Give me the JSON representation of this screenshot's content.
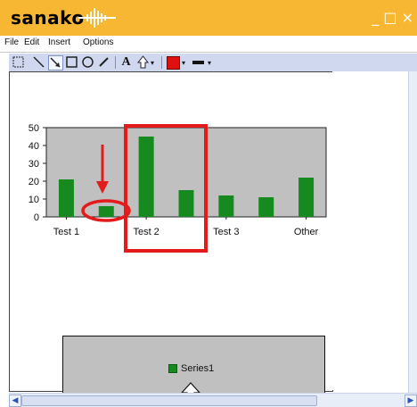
{
  "app": {
    "title": "sanako",
    "window_buttons": "_ □ ×"
  },
  "menu": {
    "items": [
      "File",
      "Edit",
      "Insert",
      "Options"
    ]
  },
  "toolbar": {
    "tools": [
      "select-rect",
      "line",
      "arrow",
      "rect",
      "ellipse",
      "pencil",
      "text",
      "arrow-up",
      "fill-color",
      "line-style"
    ],
    "fill_color": "#e01010",
    "line_color": "#111111"
  },
  "chart_data": {
    "type": "bar",
    "categories": [
      "Test 1",
      "",
      "Test 2",
      "",
      "Test 3",
      "",
      "Other"
    ],
    "x_tick_labels": [
      "Test 1",
      "Test 2",
      "Test 3",
      "Other"
    ],
    "series": [
      {
        "name": "Series1",
        "values": [
          21,
          6,
          45,
          15,
          12,
          11,
          22
        ]
      }
    ],
    "ylim": [
      0,
      50
    ],
    "yticks": [
      0,
      10,
      20,
      30,
      40,
      50
    ],
    "grid": false,
    "legend": "bottom",
    "colors": {
      "bar": "#178a1f",
      "plot_bg": "#c0c0c0",
      "annotation": "#e31b1b"
    }
  },
  "legend": {
    "label": "Series1"
  }
}
